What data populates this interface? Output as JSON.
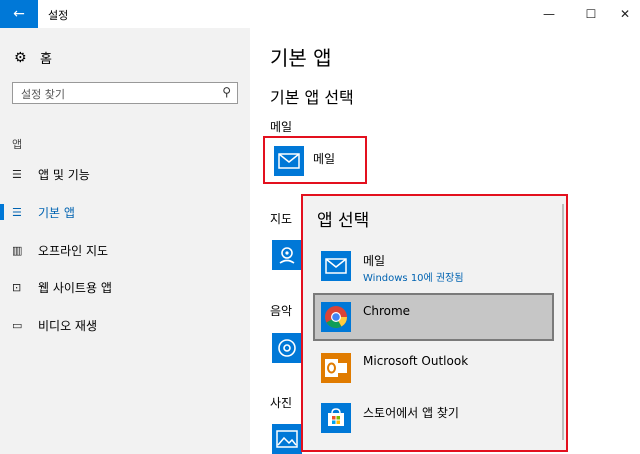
{
  "window": {
    "title": "설정",
    "back_glyph": "←",
    "minimize_glyph": "—",
    "maximize_glyph": "☐",
    "close_glyph": "✕"
  },
  "sidebar": {
    "home_label": "홈",
    "search_placeholder": "설정 찾기",
    "section_label": "앱",
    "items": [
      {
        "label": "앱 및 기능",
        "icon": "apps-list-icon"
      },
      {
        "label": "기본 앱",
        "icon": "default-apps-icon",
        "active": true
      },
      {
        "label": "오프라인 지도",
        "icon": "offline-map-icon"
      },
      {
        "label": "웹 사이트용 앱",
        "icon": "website-app-icon"
      },
      {
        "label": "비디오 재생",
        "icon": "video-playback-icon"
      }
    ]
  },
  "main": {
    "title": "기본 앱",
    "section_title": "기본 앱 선택",
    "categories": {
      "mail": "메일",
      "maps": "지도",
      "music": "음악",
      "photos": "사진"
    },
    "mail_app_label": "메일"
  },
  "popup": {
    "title": "앱 선택",
    "options": [
      {
        "name": "메일",
        "sub": "Windows 10에 권장됨",
        "icon": "mail-icon"
      },
      {
        "name": "Chrome",
        "icon": "chrome-icon",
        "selected": true
      },
      {
        "name": "Microsoft Outlook",
        "icon": "outlook-icon"
      },
      {
        "name": "스토어에서 앱 찾기",
        "icon": "store-icon"
      }
    ]
  },
  "colors": {
    "accent": "#0078d7",
    "highlight_border": "#e3101e",
    "sidebar_bg": "#f2f2f2",
    "selected_bg": "#c6c6c6"
  }
}
